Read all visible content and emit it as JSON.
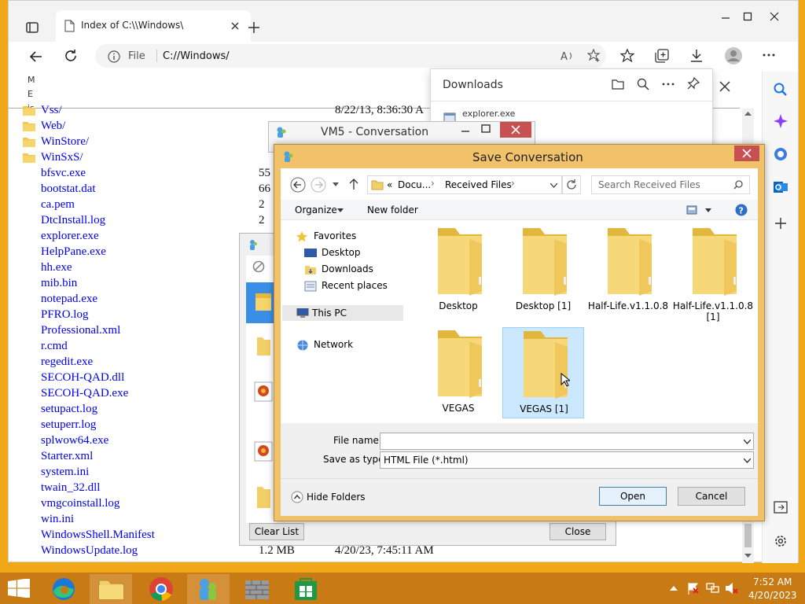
{
  "browser": {
    "tab_title": "Index of C:\\\\Windows\\",
    "address_label": "File",
    "address_value": "C://Windows/",
    "left_col_letters": [
      "M",
      "E",
      "is"
    ]
  },
  "files": [
    {
      "name": "Vss/",
      "size": "",
      "date": "8/22/13, 8:36:30 A",
      "folder": true
    },
    {
      "name": "Web/",
      "size": "",
      "date": "",
      "folder": true
    },
    {
      "name": "WinStore/",
      "size": "",
      "date": "",
      "folder": true
    },
    {
      "name": "WinSxS/",
      "size": "",
      "date": "",
      "folder": true
    },
    {
      "name": "bfsvc.exe",
      "size": "55",
      "date": "",
      "folder": false
    },
    {
      "name": "bootstat.dat",
      "size": "66",
      "date": "",
      "folder": false
    },
    {
      "name": "ca.pem",
      "size": "2",
      "date": "",
      "folder": false
    },
    {
      "name": "DtcInstall.log",
      "size": "2",
      "date": "",
      "folder": false
    },
    {
      "name": "explorer.exe",
      "size": "",
      "date": "",
      "folder": false
    },
    {
      "name": "HelpPane.exe",
      "size": "",
      "date": "",
      "folder": false
    },
    {
      "name": "hh.exe",
      "size": "",
      "date": "",
      "folder": false
    },
    {
      "name": "mib.bin",
      "size": "",
      "date": "",
      "folder": false
    },
    {
      "name": "notepad.exe",
      "size": "",
      "date": "",
      "folder": false
    },
    {
      "name": "PFRO.log",
      "size": "",
      "date": "",
      "folder": false
    },
    {
      "name": "Professional.xml",
      "size": "",
      "date": "",
      "folder": false
    },
    {
      "name": "r.cmd",
      "size": "",
      "date": "",
      "folder": false
    },
    {
      "name": "regedit.exe",
      "size": "",
      "date": "",
      "folder": false
    },
    {
      "name": "SECOH-QAD.dll",
      "size": "",
      "date": "",
      "folder": false
    },
    {
      "name": "SECOH-QAD.exe",
      "size": "",
      "date": "",
      "folder": false
    },
    {
      "name": "setupact.log",
      "size": "",
      "date": "",
      "folder": false
    },
    {
      "name": "setuperr.log",
      "size": "",
      "date": "",
      "folder": false
    },
    {
      "name": "splwow64.exe",
      "size": "",
      "date": "",
      "folder": false
    },
    {
      "name": "Starter.xml",
      "size": "",
      "date": "",
      "folder": false
    },
    {
      "name": "system.ini",
      "size": "",
      "date": "",
      "folder": false
    },
    {
      "name": "twain_32.dll",
      "size": "",
      "date": "",
      "folder": false
    },
    {
      "name": "vmgcoinstall.log",
      "size": "",
      "date": "",
      "folder": false
    },
    {
      "name": "win.ini",
      "size": "",
      "date": "",
      "folder": false
    },
    {
      "name": "WindowsShell.Manifest",
      "size": "",
      "date": "",
      "folder": false
    },
    {
      "name": "WindowsUpdate.log",
      "size": "1.2 MB",
      "date": "4/20/23, 7:45:11 AM",
      "folder": false
    }
  ],
  "downloads": {
    "title": "Downloads",
    "item": "explorer.exe"
  },
  "vm5": {
    "title": "VM5 - Conversation"
  },
  "transfer": {
    "clear_label": "Clear List",
    "close_label": "Close"
  },
  "save_dialog": {
    "title": "Save Conversation",
    "breadcrumb_prefix": "«",
    "breadcrumb": [
      "Docu...",
      "Received Files"
    ],
    "search_placeholder": "Search Received Files",
    "organize": "Organize",
    "new_folder": "New folder",
    "nav": {
      "favorites": "Favorites",
      "desktop": "Desktop",
      "downloads": "Downloads",
      "recent": "Recent places",
      "thispc": "This PC",
      "network": "Network"
    },
    "folders": [
      "Desktop",
      "Desktop [1]",
      "Half-Life.v1.1.0.8",
      "Half-Life.v1.1.0.8\n[1]",
      "VEGAS",
      "VEGAS [1]"
    ],
    "selected_index": 5,
    "filename_label": "File name:",
    "filename_value": "",
    "type_label": "Save as type:",
    "type_value": "HTML File (*.html)",
    "hide_folders": "Hide Folders",
    "open_label": "Open",
    "cancel_label": "Cancel"
  },
  "taskbar": {
    "time": "7:52 AM",
    "date": "4/20/2023"
  },
  "colors": {
    "accent": "#f2c26a",
    "close_red": "#c75050",
    "link": "#0000ee",
    "selection": "#cce8ff"
  }
}
